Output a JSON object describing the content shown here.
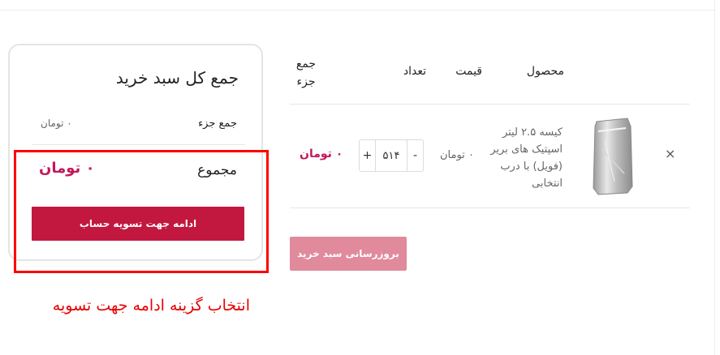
{
  "cart_table": {
    "headers": {
      "product": "محصول",
      "price": "قیمت",
      "quantity": "تعداد",
      "subtotal": "جمع جزء"
    },
    "items": [
      {
        "remove_symbol": "×",
        "product_name": "کیسه ۲.۵ لیتر اسپتیک های بریر (فویل) با درب انتخابی",
        "price": "۰ تومان",
        "quantity": "۵۱۴",
        "minus_symbol": "-",
        "plus_symbol": "+",
        "subtotal": "۰ تومان"
      }
    ],
    "update_button": "بروزرسانی سبد خرید"
  },
  "cart_totals": {
    "title": "جمع کل سبد خرید",
    "subtotal_label": "جمع جزء",
    "subtotal_value": "۰ تومان",
    "total_label": "مجموع",
    "total_value": "۰ تومان",
    "checkout_button": "ادامه جهت تسویه حساب"
  },
  "annotation": {
    "text": "انتخاب گزینه ادامه جهت تسویه",
    "color": "#e60000"
  },
  "colors": {
    "accent": "#c2185b",
    "checkout_button": "#c2183f",
    "update_button": "#e08a9c"
  },
  "icons": {
    "remove": "close-icon",
    "product_image": "foil-bag-image"
  }
}
